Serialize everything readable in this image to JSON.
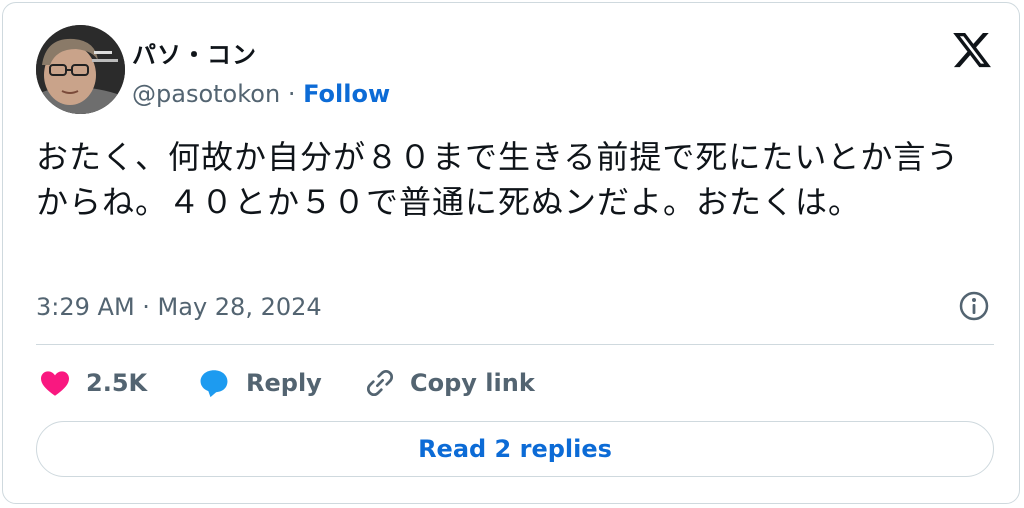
{
  "author": {
    "display_name": "パソ・コン",
    "handle": "@pasotokon",
    "separator": "·",
    "follow_label": "Follow"
  },
  "tweet": {
    "text": "おたく、何故か自分が８０まで生きる前提で死にたいとか言うからね。４０とか５０で普通に死ぬンだよ。おたくは。",
    "timestamp": "3:29 AM · May 28, 2024"
  },
  "actions": {
    "likes": "2.5K",
    "reply_label": "Reply",
    "copy_link_label": "Copy link"
  },
  "read_replies_label": "Read 2 replies",
  "icons": {
    "like": "heart-icon",
    "reply": "speech-bubble-icon",
    "copy": "link-icon",
    "brand": "x-logo-icon",
    "info": "info-icon"
  },
  "colors": {
    "like": "#f91880",
    "reply": "#1d9bf0",
    "link_blue": "#0c6bd6",
    "muted": "#536471",
    "border": "#cfd9de"
  }
}
